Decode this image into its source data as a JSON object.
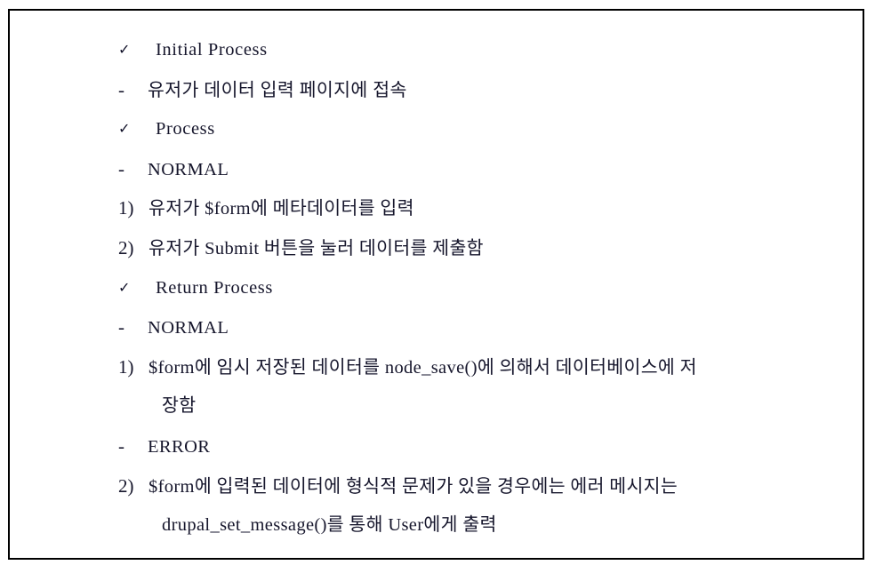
{
  "document": {
    "background_color": "#ffffff",
    "border_color": "#000000",
    "text_color": "#16162c",
    "markers": {
      "check": "✓",
      "dash": "-",
      "item_1": "1)",
      "item_2": "2)"
    },
    "lines": [
      {
        "kind": "head",
        "marker": "✓",
        "text": "Initial Process"
      },
      {
        "kind": "sub",
        "marker": "-",
        "text": "유저가 데이터 입력 페이지에 접속"
      },
      {
        "kind": "head",
        "marker": "✓",
        "text": "Process"
      },
      {
        "kind": "sub",
        "marker": "-",
        "text": "NORMAL"
      },
      {
        "kind": "item",
        "marker": "1)",
        "text": "유저가 $form에 메타데이터를 입력"
      },
      {
        "kind": "item",
        "marker": "2)",
        "text": "유저가 Submit 버튼을 눌러 데이터를 제출함"
      },
      {
        "kind": "head",
        "marker": "✓",
        "text": "Return Process"
      },
      {
        "kind": "sub",
        "marker": "-",
        "text": "NORMAL"
      },
      {
        "kind": "item",
        "marker": "1)",
        "text": "$form에 임시 저장된 데이터를 node_save()에 의해서 데이터베이스에 저"
      },
      {
        "kind": "cont",
        "marker": "",
        "text": "장함"
      },
      {
        "kind": "sub",
        "marker": "-",
        "text": "ERROR"
      },
      {
        "kind": "item",
        "marker": "2)",
        "text": "$form에 입력된 데이터에 형식적 문제가 있을 경우에는 에러 메시지는"
      },
      {
        "kind": "cont",
        "marker": "",
        "text": "drupal_set_message()를 통해 User에게 출력"
      }
    ]
  }
}
